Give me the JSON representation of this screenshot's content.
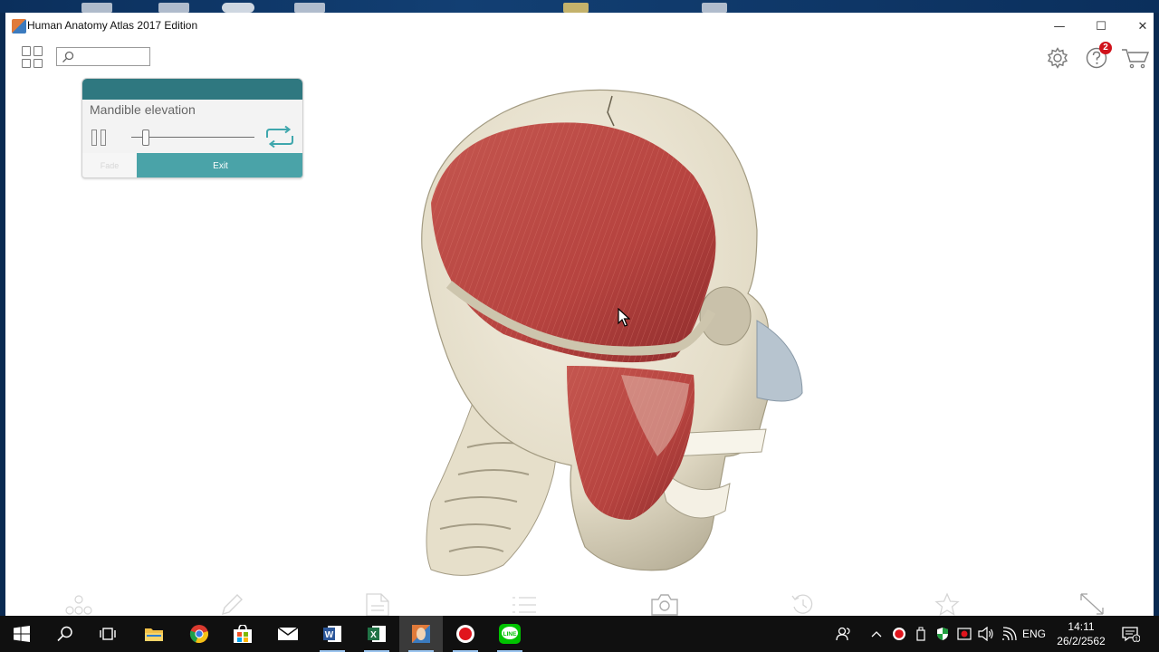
{
  "window": {
    "title": "Human Anatomy Atlas 2017 Edition",
    "minimize_glyph": "—",
    "maximize_glyph": "☐",
    "close_glyph": "✕"
  },
  "toolbar": {
    "search_placeholder": "",
    "help_badge_count": "2",
    "icons": [
      "apps-grid-icon",
      "search-icon",
      "settings-gear-icon",
      "help-icon",
      "cart-icon"
    ]
  },
  "animation_panel": {
    "title": "Mandible elevation",
    "fade_label": "Fade",
    "exit_label": "Exit",
    "progress": 0.12
  },
  "bottom_toolbar": {
    "icons": [
      "layers-icon",
      "pencil-icon",
      "notes-icon",
      "list-icon",
      "camera-icon",
      "history-icon",
      "favorite-star-icon",
      "expand-icon"
    ]
  },
  "taskbar": {
    "language": "ENG",
    "time": "14:11",
    "date": "26/2/2562",
    "notification_count": "1",
    "apps": [
      "start",
      "search",
      "task-view",
      "file-explorer",
      "chrome",
      "store",
      "mail",
      "word",
      "excel",
      "anatomy-atlas",
      "recorder",
      "line"
    ]
  },
  "colors": {
    "panel_header": "#2f7880",
    "exit_button": "#4aa3a8",
    "badge": "#d0121b"
  }
}
